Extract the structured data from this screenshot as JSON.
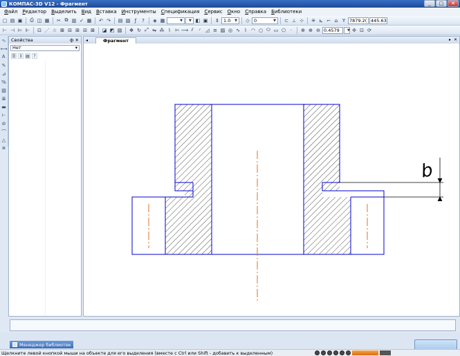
{
  "window": {
    "title": "КОМПАС-3D V12 - Фрагмент"
  },
  "menu": [
    "Файл",
    "Редактор",
    "Выделить",
    "Вид",
    "Вставка",
    "Инструменты",
    "Спецификация",
    "Сервис",
    "Окно",
    "Справка",
    "Библиотеки"
  ],
  "toolbar1": {
    "line_scale": "1.0",
    "layer": "0",
    "coord_x": "7879.2(",
    "coord_y": "445.63"
  },
  "toolbar2": {
    "zoom": "0.4579"
  },
  "properties": {
    "title": "Свойства",
    "panel_controls": "ф ✕",
    "selection": "Нет"
  },
  "document": {
    "tab": "Фрагмент"
  },
  "library_manager": {
    "label": "Менеджер библиотек"
  },
  "status": {
    "hint": "Щелкните левой кнопкой мыши на объекте для его выделения (вместе с Ctrl или Shift - добавить к выделенным)"
  },
  "drawing": {
    "dimension_label": "b",
    "colors": {
      "outline": "#0000cc",
      "hatch": "#000000",
      "axis": "#e07020",
      "dim": "#000000"
    }
  }
}
